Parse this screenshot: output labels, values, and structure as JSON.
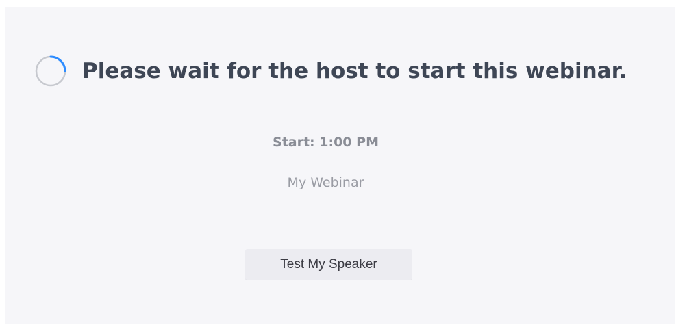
{
  "waiting": {
    "heading": "Please wait for the host to start this webinar.",
    "start_time": "Start: 1:00 PM",
    "webinar_name": "My Webinar",
    "test_speaker_label": "Test My Speaker"
  },
  "colors": {
    "spinner_accent": "#2d8cff",
    "spinner_track": "#c7c9cf",
    "heading_text": "#3e4655",
    "panel_background": "#f6f6f9"
  },
  "icons": {
    "spinner": "loading-spinner-icon"
  }
}
